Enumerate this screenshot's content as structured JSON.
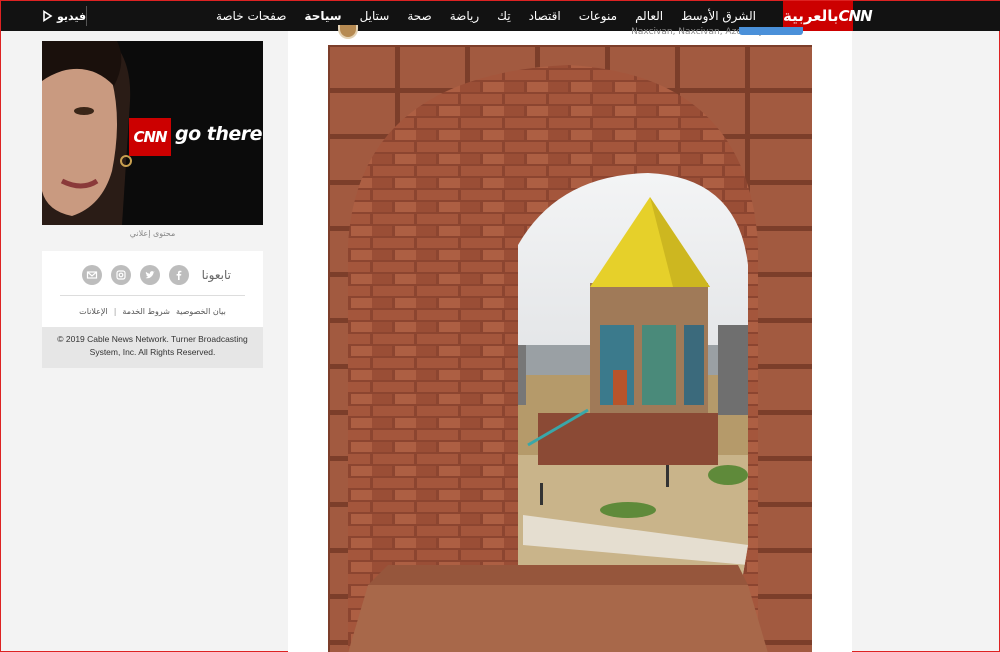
{
  "nav": {
    "logo_brand": "CNN",
    "logo_text": "بالعربية",
    "items": [
      {
        "label": "الشرق الأوسط",
        "bold": false
      },
      {
        "label": "العالم",
        "bold": false
      },
      {
        "label": "منوعات",
        "bold": false
      },
      {
        "label": "اقتصاد",
        "bold": false
      },
      {
        "label": "تِك",
        "bold": false
      },
      {
        "label": "رياضة",
        "bold": false
      },
      {
        "label": "صحة",
        "bold": false
      },
      {
        "label": "ستايل",
        "bold": false
      },
      {
        "label": "سياحة",
        "bold": true
      },
      {
        "label": "صفحات خاصة",
        "bold": false
      }
    ],
    "video_label": "فيديو",
    "video_icon": "play-icon"
  },
  "post": {
    "location": "Naxcivan, Naxcivan, Azerbaijan",
    "photo_alt_icon": "mausoleum-through-brick-arch"
  },
  "ad": {
    "brand": "CNN",
    "tagline": "go there",
    "label": "محتوى إعلاني"
  },
  "follow": {
    "title": "تابعونا",
    "icons": [
      "facebook-icon",
      "twitter-icon",
      "instagram-icon",
      "email-icon"
    ],
    "links": [
      "بيان الخصوصية",
      "شروط الخدمة",
      "الإعلانات"
    ],
    "separator": "|"
  },
  "copyright": "© 2019 Cable News Network. Turner Broadcasting System, Inc. All Rights Reserved.",
  "colors": {
    "brand_red": "#cc0000",
    "nav_bg": "#121212",
    "page_bg": "#f3f3f3"
  }
}
